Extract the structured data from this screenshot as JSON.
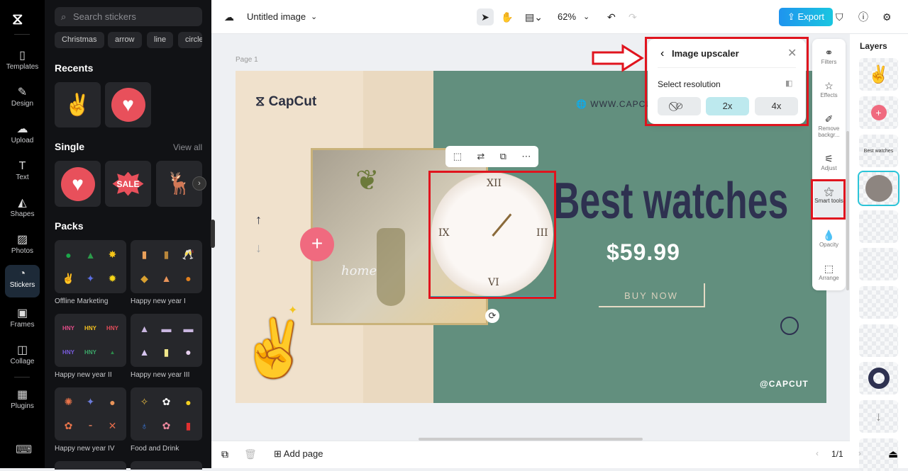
{
  "rail": {
    "items": [
      {
        "label": "Templates",
        "icon": "templates-icon"
      },
      {
        "label": "Design",
        "icon": "design-icon"
      },
      {
        "label": "Upload",
        "icon": "upload-icon"
      },
      {
        "label": "Text",
        "icon": "text-icon"
      },
      {
        "label": "Shapes",
        "icon": "shapes-icon"
      },
      {
        "label": "Photos",
        "icon": "photos-icon"
      },
      {
        "label": "Stickers",
        "icon": "stickers-icon",
        "active": true
      },
      {
        "label": "Frames",
        "icon": "frames-icon"
      },
      {
        "label": "Collage",
        "icon": "collage-icon"
      },
      {
        "label": "Plugins",
        "icon": "plugins-icon"
      }
    ]
  },
  "panel": {
    "search_placeholder": "Search stickers",
    "chips": [
      "Christmas",
      "arrow",
      "line",
      "circle"
    ],
    "recents": "Recents",
    "single": "Single",
    "view_all": "View all",
    "sale": "SALE",
    "packs_title": "Packs",
    "packs": [
      "Offline Marketing",
      "Happy new year I",
      "Happy new year II",
      "Happy new year III",
      "Happy new year IV",
      "Food and Drink"
    ]
  },
  "topbar": {
    "title": "Untitled image",
    "zoom": "62%",
    "export": "Export"
  },
  "canvas": {
    "page_label": "Page 1",
    "brand": "CapCut",
    "website": "WWW.CAPCUT",
    "headline": "Best watches",
    "price": "$59.99",
    "cta": "BUY NOW",
    "handle": "@CAPCUT",
    "script_text": "home"
  },
  "popup": {
    "title": "Image upscaler",
    "subtitle": "Select resolution",
    "options": [
      "2x",
      "4x"
    ],
    "selected": "2x"
  },
  "tools": [
    "Filters",
    "Effects",
    "Remove backgr...",
    "Adjust",
    "Smart tools",
    "Opacity",
    "Arrange"
  ],
  "layers": {
    "title": "Layers",
    "text_layer": "Best watches"
  },
  "bottom": {
    "add_page": "Add page",
    "page_count": "1/1"
  },
  "colors": {
    "accent": "#1fa4e8",
    "highlight": "#e0141e",
    "green": "#628f7e",
    "beige": "#f0e1cc"
  }
}
